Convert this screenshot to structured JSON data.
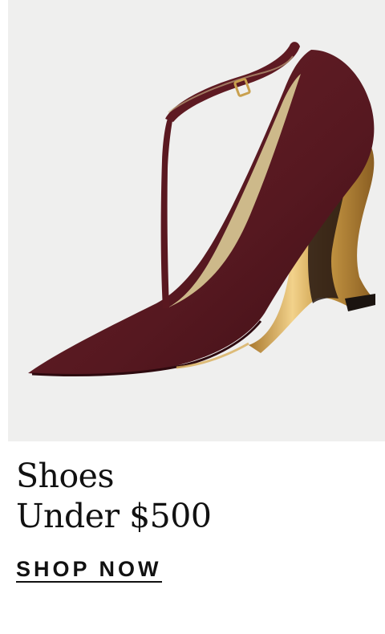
{
  "promo": {
    "image_alt": "burgundy leather T-strap pointed-toe pump with sculpted gold wedge heel",
    "headline_line1": "Shoes",
    "headline_line2": "Under $500",
    "cta_label": "SHOP NOW"
  },
  "colors": {
    "background": "#ffffff",
    "photo_bg": "#efefee",
    "leather": "#5e1a22",
    "lining": "#cdb98a",
    "gold": "#d8ae5a",
    "text": "#111111"
  }
}
